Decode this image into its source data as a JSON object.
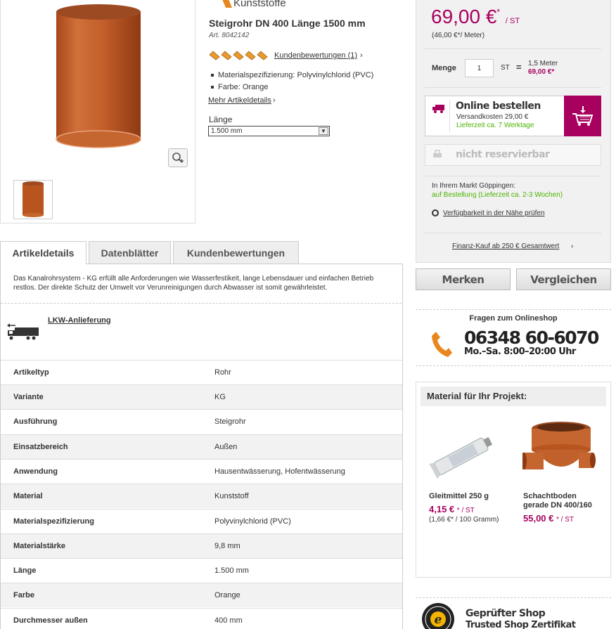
{
  "product": {
    "brand": "Kunststoffe",
    "title": "Steigrohr DN 400 Länge 1500 mm",
    "article_no": "Art. 8042142",
    "rating_stars": 5,
    "reviews_link": "Kundenbewertungen (1)",
    "bullets": [
      "Materialspezifizierung: Polyvinylchlorid (PVC)",
      "Farbe: Orange"
    ],
    "more_link": "Mehr Artikeldetails",
    "length_label": "Länge",
    "length_value": "1.500 mm"
  },
  "tabs": [
    {
      "label": "Artikeldetails"
    },
    {
      "label": "Datenblätter"
    },
    {
      "label": "Kundenbewertungen"
    }
  ],
  "details": {
    "description": "Das Kanalrohrsystem - KG erfüllt alle Anforderungen wie Wasserfestikeit, lange Lebensdauer und einfachen Betrieb restlos. Der direkte Schutz der Umwelt vor Verunreinigungen durch Abwasser ist somit gewährleistet.",
    "delivery_link": "LKW-Anlieferung",
    "specs": [
      {
        "key": "Artikeltyp",
        "value": "Rohr"
      },
      {
        "key": "Variante",
        "value": "KG"
      },
      {
        "key": "Ausführung",
        "value": "Steigrohr"
      },
      {
        "key": "Einsatzbereich",
        "value": "Außen"
      },
      {
        "key": "Anwendung",
        "value": "Hausentwässerung, Hofentwässerung"
      },
      {
        "key": "Material",
        "value": "Kunststoff"
      },
      {
        "key": "Materialspezifizierung",
        "value": "Polyvinylchlorid (PVC)"
      },
      {
        "key": "Materialstärke",
        "value": "9,8 mm"
      },
      {
        "key": "Länge",
        "value": "1.500 mm"
      },
      {
        "key": "Farbe",
        "value": "Orange"
      },
      {
        "key": "Durchmesser außen",
        "value": "400 mm"
      }
    ]
  },
  "buybox": {
    "price": "69,00 €",
    "price_star": "*",
    "price_unit": "/ ST",
    "base_price": "(46,00 €*/ Meter)",
    "qty_label": "Menge",
    "qty_value": "1",
    "qty_unit": "ST",
    "eq": "=",
    "qty_meters": "1,5 Meter",
    "qty_total": "69,00 €*",
    "order_title": "Online bestellen",
    "shipping": "Versandkosten 29,00 €",
    "delivery_time": "Lieferzeit ca. 7 Werktage",
    "reserve": "nicht reservierbar",
    "market": "In Ihrem Markt Göppingen:",
    "market_avail": "auf Bestellung (Lieferzeit ca. 2-3 Wochen)",
    "check_avail": "Verfügbarkeit in der Nähe prüfen",
    "finance": "Finanz-Kauf ab 250 € Gesamtwert"
  },
  "actions": {
    "remember": "Merken",
    "compare": "Vergleichen"
  },
  "contact": {
    "title": "Fragen zum Onlineshop",
    "phone": "06348 60-6070",
    "hours": "Mo.–Sa. 8:00–20:00 Uhr"
  },
  "materials": {
    "title": "Material für Ihr Projekt:",
    "items": [
      {
        "name": "Gleitmittel 250 g",
        "price": "4,15 €",
        "unit": "* / ST",
        "base": "(1,66 €* / 100 Gramm)"
      },
      {
        "name_line1": "Schachtboden",
        "name_line2": "gerade DN 400/160",
        "price": "55,00 €",
        "unit": "* / ST"
      }
    ]
  },
  "trust": {
    "title": "Geprüfter Shop",
    "subtitle": "Trusted Shop Zertifikat"
  },
  "colors": {
    "accent": "#a8005f",
    "green": "#4cb300",
    "pipe": "#c8622a"
  }
}
